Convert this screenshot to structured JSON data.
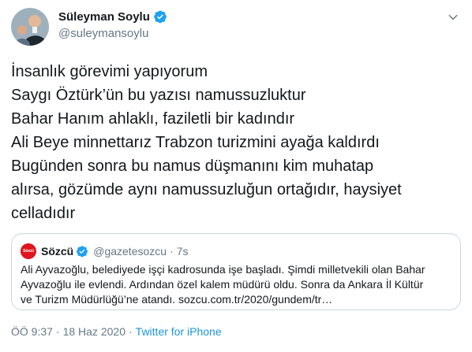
{
  "author": {
    "display_name": "Süleyman Soylu",
    "handle": "@suleymansoylu"
  },
  "tweet_lines": [
    "İnsanlık görevimi yapıyorum",
    "Saygı Öztürk’ün bu yazısı namussuzluktur",
    "Bahar Hanım ahlaklı, faziletli bir kadındır",
    "Ali Beye minnettarız Trabzon turizmini ayağa kaldırdı",
    "Bugünden sonra bu namus düşmanını kim muhatap",
    "alırsa, gözümde aynı namussuzluğun ortağıdır, haysiyet",
    "celladıdır"
  ],
  "quoted": {
    "logo_text": "Sözcü",
    "display_name": "Sözcü",
    "handle": "@gazetesozcu",
    "separator": "·",
    "time": "7s",
    "lines": [
      "Ali Ayvazoğlu, belediyede işçi kadrosunda işe başladı. Şimdi milletvekili olan Bahar",
      "Ayvazoğlu ile evlendi. Ardından özel kalem müdürü oldu. Sonra da Ankara İl Kültür",
      "ve Turizm Müdürlüğü’ne atandı. sozcu.com.tr/2020/gundem/tr…"
    ]
  },
  "meta": {
    "time": "ÖÖ 9:37",
    "separator1": "·",
    "date": "18 Haz 2020",
    "separator2": "·",
    "source": "Twitter for iPhone"
  },
  "colors": {
    "verified": "#1da1f2",
    "link": "#1b95e0",
    "muted": "#657786",
    "sozcu_red": "#e0141e"
  },
  "icons": {
    "verified": "verified-badge-icon",
    "caret": "chevron-down-icon"
  }
}
